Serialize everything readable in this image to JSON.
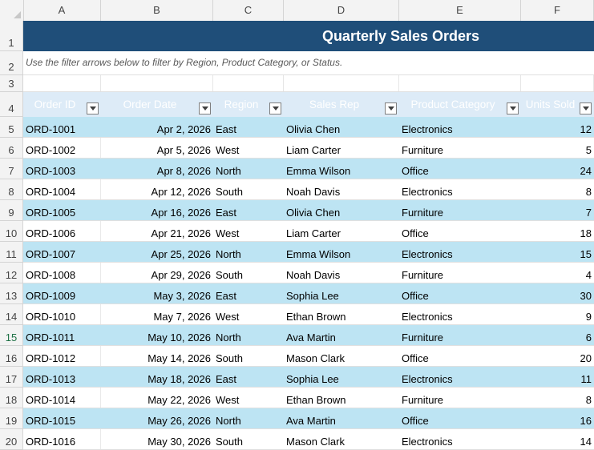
{
  "columns": [
    "A",
    "B",
    "C",
    "D",
    "E",
    "F"
  ],
  "row_numbers": [
    "1",
    "2",
    "3",
    "4",
    "5",
    "6",
    "7",
    "8",
    "9",
    "10",
    "11",
    "12",
    "13",
    "14",
    "15",
    "16",
    "17",
    "18",
    "19",
    "20"
  ],
  "title": "Quarterly Sales Orders",
  "note": "Use the filter arrows below to filter by Region, Product Category, or Status.",
  "headers": [
    "Order ID",
    "Order Date",
    "Region",
    "Sales Rep",
    "Product Category",
    "Units Sold"
  ],
  "rows": [
    [
      "ORD-1001",
      "Apr 2, 2026",
      "East",
      "Olivia Chen",
      "Electronics",
      "12"
    ],
    [
      "ORD-1002",
      "Apr 5, 2026",
      "West",
      "Liam Carter",
      "Furniture",
      "5"
    ],
    [
      "ORD-1003",
      "Apr 8, 2026",
      "North",
      "Emma Wilson",
      "Office",
      "24"
    ],
    [
      "ORD-1004",
      "Apr 12, 2026",
      "South",
      "Noah Davis",
      "Electronics",
      "8"
    ],
    [
      "ORD-1005",
      "Apr 16, 2026",
      "East",
      "Olivia Chen",
      "Furniture",
      "7"
    ],
    [
      "ORD-1006",
      "Apr 21, 2026",
      "West",
      "Liam Carter",
      "Office",
      "18"
    ],
    [
      "ORD-1007",
      "Apr 25, 2026",
      "North",
      "Emma Wilson",
      "Electronics",
      "15"
    ],
    [
      "ORD-1008",
      "Apr 29, 2026",
      "South",
      "Noah Davis",
      "Furniture",
      "4"
    ],
    [
      "ORD-1009",
      "May 3, 2026",
      "East",
      "Sophia Lee",
      "Office",
      "30"
    ],
    [
      "ORD-1010",
      "May 7, 2026",
      "West",
      "Ethan Brown",
      "Electronics",
      "9"
    ],
    [
      "ORD-1011",
      "May 10, 2026",
      "North",
      "Ava Martin",
      "Furniture",
      "6"
    ],
    [
      "ORD-1012",
      "May 14, 2026",
      "South",
      "Mason Clark",
      "Office",
      "20"
    ],
    [
      "ORD-1013",
      "May 18, 2026",
      "East",
      "Sophia Lee",
      "Electronics",
      "11"
    ],
    [
      "ORD-1014",
      "May 22, 2026",
      "West",
      "Ethan Brown",
      "Furniture",
      "8"
    ],
    [
      "ORD-1015",
      "May 26, 2026",
      "North",
      "Ava Martin",
      "Office",
      "16"
    ],
    [
      "ORD-1016",
      "May 30, 2026",
      "South",
      "Mason Clark",
      "Electronics",
      "14"
    ]
  ],
  "active_row": "15",
  "colors": {
    "title_bg": "#1f4e79",
    "band": "#bde4f3",
    "header_band": "#ddebf7"
  }
}
